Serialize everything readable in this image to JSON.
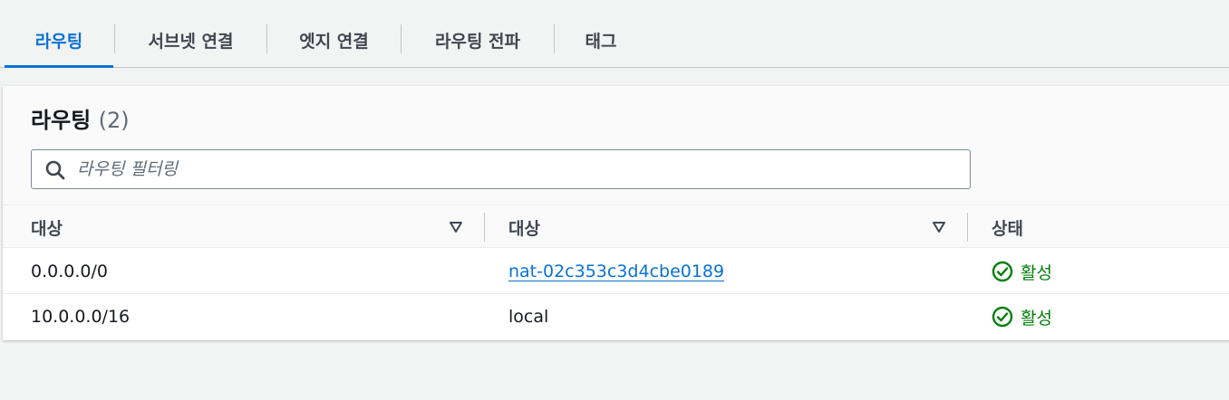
{
  "tabs": [
    {
      "label": "라우팅",
      "active": true
    },
    {
      "label": "서브넷 연결",
      "active": false
    },
    {
      "label": "엣지 연결",
      "active": false
    },
    {
      "label": "라우팅 전파",
      "active": false
    },
    {
      "label": "태그",
      "active": false
    }
  ],
  "panel": {
    "title": "라우팅",
    "count": "(2)",
    "search_placeholder": "라우팅 필터링"
  },
  "table": {
    "columns": [
      "대상",
      "대상",
      "상태"
    ],
    "rows": [
      {
        "destination": "0.0.0.0/0",
        "target": "nat-02c353c3d4cbe0189",
        "target_is_link": true,
        "status": "활성"
      },
      {
        "destination": "10.0.0.0/16",
        "target": "local",
        "target_is_link": false,
        "status": "활성"
      }
    ]
  },
  "colors": {
    "accent": "#0972d3",
    "success": "#037f0c"
  },
  "icons": {
    "search": "search-icon",
    "sort": "sort-caret-down-icon",
    "status": "check-circle-icon"
  }
}
